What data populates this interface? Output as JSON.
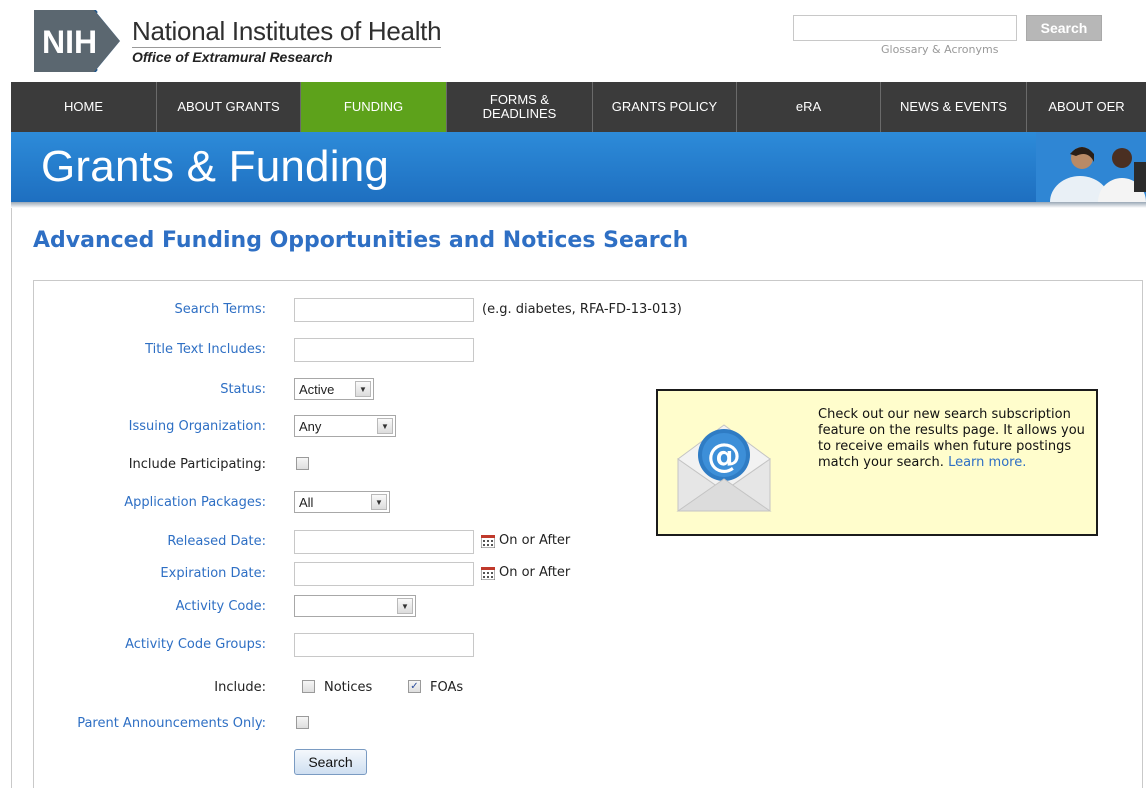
{
  "header": {
    "logo_text": "NIH",
    "title": "National Institutes of Health",
    "subtitle": "Office of Extramural Research",
    "search_placeholder": "",
    "search_button": "Search",
    "glossary_link": "Glossary & Acronyms"
  },
  "nav": {
    "items": [
      {
        "label": "HOME"
      },
      {
        "label": "ABOUT GRANTS"
      },
      {
        "label": "FUNDING"
      },
      {
        "label": "FORMS & DEADLINES"
      },
      {
        "label": "GRANTS POLICY"
      },
      {
        "label": "eRA"
      },
      {
        "label": "NEWS & EVENTS"
      },
      {
        "label": "ABOUT OER"
      }
    ],
    "active_color": "#5da21b"
  },
  "banner": {
    "title": "Grants & Funding"
  },
  "page": {
    "title": "Advanced Funding Opportunities and Notices Search"
  },
  "form": {
    "search_terms": {
      "label": "Search Terms:",
      "value": "",
      "hint": "(e.g. diabetes, RFA-FD-13-013)"
    },
    "title_text": {
      "label": "Title Text Includes:",
      "value": ""
    },
    "status": {
      "label": "Status:",
      "value": "Active"
    },
    "issuing_org": {
      "label": "Issuing Organization:",
      "value": "Any"
    },
    "include_participating": {
      "label": "Include Participating:",
      "checked": false
    },
    "application_packages": {
      "label": "Application Packages:",
      "value": "All"
    },
    "released_date": {
      "label": "Released Date:",
      "value": "",
      "qualifier": "On or After"
    },
    "expiration_date": {
      "label": "Expiration Date:",
      "value": "",
      "qualifier": "On or After"
    },
    "activity_code": {
      "label": "Activity Code:",
      "value": ""
    },
    "activity_code_groups": {
      "label": "Activity Code Groups:",
      "value": ""
    },
    "include": {
      "label": "Include:",
      "notices": {
        "label": "Notices",
        "checked": false
      },
      "foas": {
        "label": "FOAs",
        "checked": true
      }
    },
    "parent_only": {
      "label": "Parent Announcements Only:",
      "checked": false
    },
    "submit_label": "Search"
  },
  "promo": {
    "text": "Check out our new search subscription feature on the results page. It allows you to receive emails when future postings match your search.",
    "link": "Learn more."
  },
  "colors": {
    "link": "#2e6fc4",
    "banner": "#2d8bd9",
    "nav": "#3b3b3b"
  }
}
